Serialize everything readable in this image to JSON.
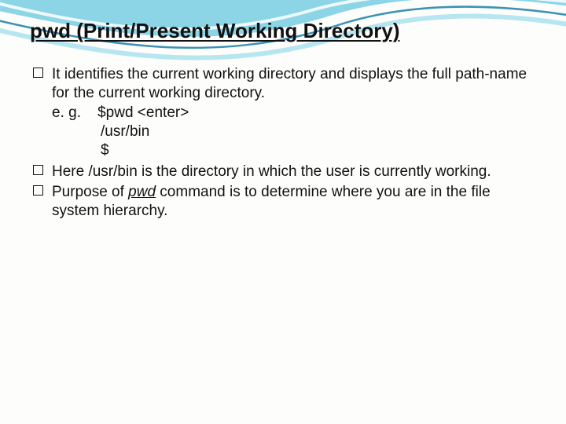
{
  "title": "pwd (Print/Present Working Directory)",
  "bullets": [
    {
      "text": "It identifies the current working directory and displays the full path-name for the current working directory.",
      "example_label": "e. g.",
      "example_cmd": "$pwd <enter>",
      "example_out1": "/usr/bin",
      "example_out2": "$"
    },
    {
      "text": "Here /usr/bin is the directory in which the user is currently working."
    },
    {
      "prefix": "Purpose of ",
      "underlined": "pwd",
      "suffix": " command is to determine where you are in the file system hierarchy."
    }
  ]
}
